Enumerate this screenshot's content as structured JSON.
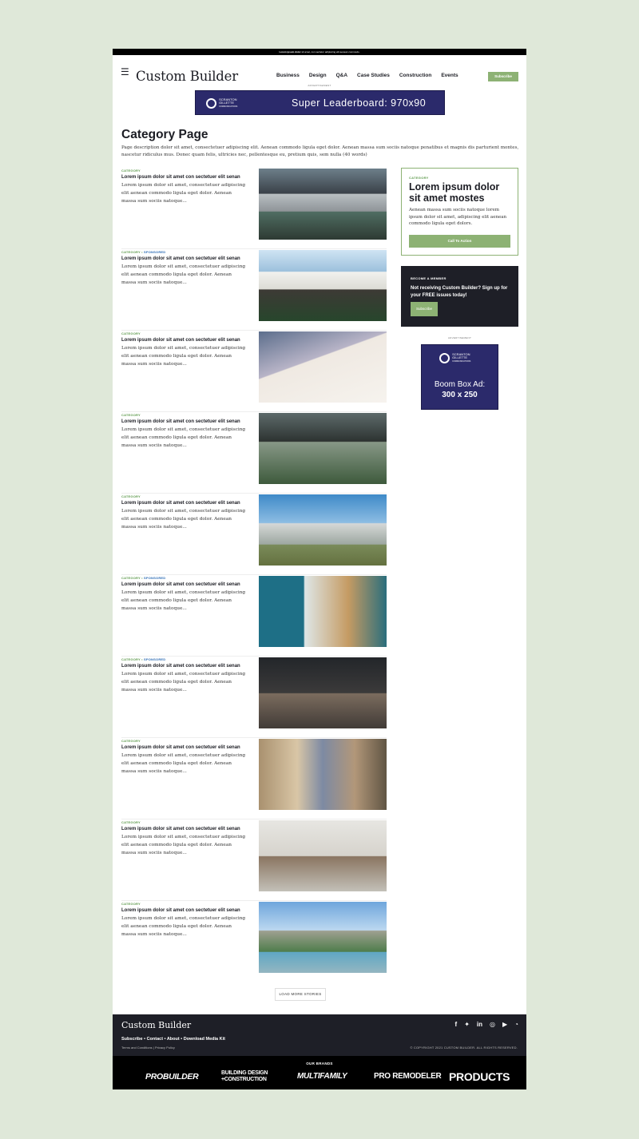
{
  "topbar": {
    "bold": "Lorem ipsum dolor",
    "text": "sit amet, con sectetur adipiscing elit aenean commodo."
  },
  "header": {
    "logo": "Custom Builder",
    "nav": [
      "Business",
      "Design",
      "Q&A",
      "Case Studies",
      "Construction",
      "Events"
    ],
    "subscribe": "Subscribe"
  },
  "ads": {
    "label": "ADVERTISEMENT",
    "sponsor_line1": "SCRANTON",
    "sponsor_line2": "GILLETTE",
    "sponsor_line3": "COMMUNICATIONS",
    "leaderboard_text": "Super Leaderboard: 970x90",
    "boombox_line1": "Boom Box Ad:",
    "boombox_line2": "300 x 250"
  },
  "page": {
    "title": "Category Page",
    "description": "Page description dolor sit amet, consectetuer adipiscing elit. Aenean commodo ligula eget dolor. Aenean massa sum sociis natoque penatibus et magnis dis parturient montes, nascetur ridiculus mus. Donec quam felis, ultricies nec, pellentesque eu, pretium quis, sem nulla (40 words)"
  },
  "articles": [
    {
      "category": "CATEGORY",
      "sponsored": "",
      "title": "Lorem ipsum dolor sit amet con sectetuer elit senan",
      "excerpt": "Lorem ipsum dolor sit amet, consectetuer adipiscing elit aenean commodo ligula eget dolor. Aenean massa sum sociis natoque..."
    },
    {
      "category": "CATEGORY",
      "sponsored": "SPONSORED",
      "title": "Lorem ipsum dolor sit amet con sectetuer elit senan",
      "excerpt": "Lorem ipsum dolor sit amet, consectetuer adipiscing elit aenean commodo ligula eget dolor. Aenean massa sum sociis natoque..."
    },
    {
      "category": "CATEGORY",
      "sponsored": "",
      "title": "Lorem ipsum dolor sit amet con sectetuer elit senan",
      "excerpt": "Lorem ipsum dolor sit amet, consectetuer adipiscing elit aenean commodo ligula eget dolor. Aenean massa sum sociis natoque..."
    },
    {
      "category": "CATEGORY",
      "sponsored": "",
      "title": "Lorem ipsum dolor sit amet con sectetuer elit senan",
      "excerpt": "Lorem ipsum dolor sit amet, consectetuer adipiscing elit aenean commodo ligula eget dolor. Aenean massa sum sociis natoque..."
    },
    {
      "category": "CATEGORY",
      "sponsored": "",
      "title": "Lorem ipsum dolor sit amet con sectetuer elit senan",
      "excerpt": "Lorem ipsum dolor sit amet, consectetuer adipiscing elit aenean commodo ligula eget dolor. Aenean massa sum sociis natoque..."
    },
    {
      "category": "CATEGORY",
      "sponsored": "SPONSORED",
      "title": "Lorem ipsum dolor sit amet con sectetuer elit senan",
      "excerpt": "Lorem ipsum dolor sit amet, consectetuer adipiscing elit aenean commodo ligula eget dolor. Aenean massa sum sociis natoque..."
    },
    {
      "category": "CATEGORY",
      "sponsored": "SPONSORED",
      "title": "Lorem ipsum dolor sit amet con sectetuer elit senan",
      "excerpt": "Lorem ipsum dolor sit amet, consectetuer adipiscing elit aenean commodo ligula eget dolor. Aenean massa sum sociis natoque..."
    },
    {
      "category": "CATEGORY",
      "sponsored": "",
      "title": "Lorem ipsum dolor sit amet con sectetuer elit senan",
      "excerpt": "Lorem ipsum dolor sit amet, consectetuer adipiscing elit aenean commodo ligula eget dolor. Aenean massa sum sociis natoque..."
    },
    {
      "category": "CATEGORY",
      "sponsored": "",
      "title": "Lorem ipsum dolor sit amet con sectetuer elit senan",
      "excerpt": "Lorem ipsum dolor sit amet, consectetuer adipiscing elit aenean commodo ligula eget dolor. Aenean massa sum sociis natoque..."
    },
    {
      "category": "CATEGORY",
      "sponsored": "",
      "title": "Lorem ipsum dolor sit amet con sectetuer elit senan",
      "excerpt": "Lorem ipsum dolor sit amet, consectetuer adipiscing elit aenean commodo ligula eget dolor. Aenean massa sum sociis natoque..."
    }
  ],
  "load_more": "LOAD MORE STORIES",
  "sidebar": {
    "promo": {
      "category": "CATEGORY",
      "title": "Lorem ipsum dolor sit amet mostes",
      "text": "Aenean massa sum sociis natoque lorem ipsum dolor sit amet, adipiscing elit aenean commodo ligula eget dolors.",
      "button": "Call To Action"
    },
    "member": {
      "label": "BECOME A MEMBER",
      "text": "Not receiving Custom Builder? Sign up for your FREE issues today!",
      "button": "Subscribe"
    }
  },
  "footer": {
    "logo": "Custom Builder",
    "links": "Subscribe  •  Contact  •  About  •  Download Media Kit",
    "legal": "Terms and Conditions  |  Privacy Policy",
    "copyright": "© COPYRIGHT 2021 CUSTOM BUILDER. ALL RIGHTS RESERVED.",
    "social": [
      "facebook-icon",
      "twitter-icon",
      "linkedin-icon",
      "instagram-icon",
      "youtube-icon",
      "rss-icon"
    ]
  },
  "brands": {
    "label": "OUR BRANDS",
    "items": [
      "PROBUILDER",
      "BUILDING DESIGN +CONSTRUCTION",
      "MULTIFAMILY",
      "PRO REMODELER",
      "PRODUCTS"
    ]
  },
  "colors": {
    "accent": "#8db274",
    "category": "#5d9a4c",
    "sponsored": "#2e6db5",
    "dark": "#1e1f27",
    "ad": "#2b2a6b"
  }
}
